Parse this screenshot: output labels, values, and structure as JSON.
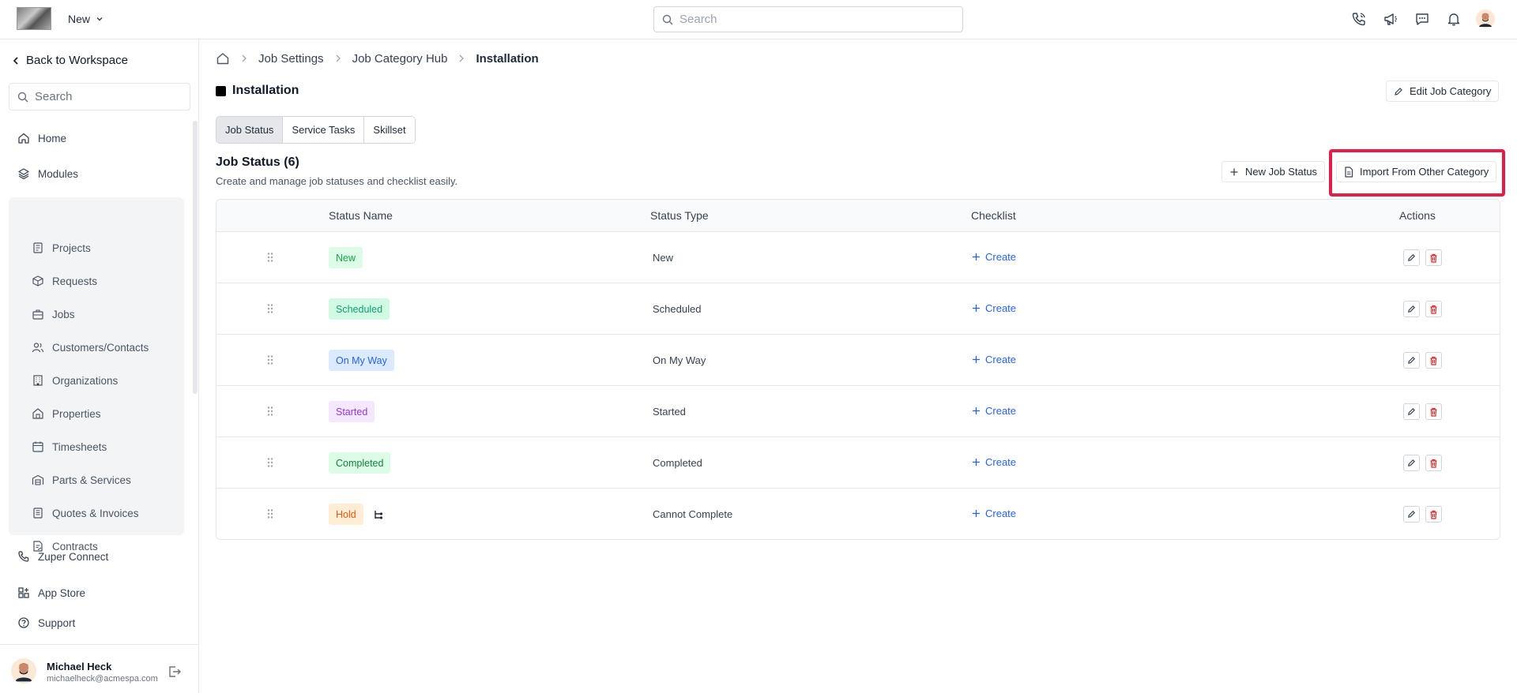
{
  "topbar": {
    "workspace": "New",
    "search_placeholder": "Search"
  },
  "sidebar": {
    "back": "Back to Workspace",
    "search_placeholder": "Search",
    "home": "Home",
    "modules": "Modules",
    "module_items": [
      {
        "label": "Projects",
        "icon": "projects-icon"
      },
      {
        "label": "Requests",
        "icon": "requests-icon"
      },
      {
        "label": "Jobs",
        "icon": "briefcase-icon"
      },
      {
        "label": "Customers/Contacts",
        "icon": "users-icon"
      },
      {
        "label": "Organizations",
        "icon": "building-icon"
      },
      {
        "label": "Properties",
        "icon": "property-icon"
      },
      {
        "label": "Timesheets",
        "icon": "calendar-icon"
      },
      {
        "label": "Parts & Services",
        "icon": "warehouse-icon"
      },
      {
        "label": "Quotes & Invoices",
        "icon": "invoice-icon"
      },
      {
        "label": "Contracts",
        "icon": "contract-icon"
      }
    ],
    "zuper_connect": "Zuper Connect",
    "app_store": "App Store",
    "support": "Support",
    "user": {
      "name": "Michael Heck",
      "email": "michaelheck@acmespa.com"
    }
  },
  "breadcrumb": [
    "Job Settings",
    "Job Category Hub",
    "Installation"
  ],
  "page": {
    "title": "Installation",
    "edit_button": "Edit Job Category",
    "tabs": [
      "Job Status",
      "Service Tasks",
      "Skillset"
    ],
    "active_tab": "Job Status",
    "section_title": "Job Status (6)",
    "section_desc": "Create and manage job statuses and checklist easily.",
    "new_button": "New Job Status",
    "import_button": "Import From Other Category"
  },
  "table": {
    "headers": [
      "Status Name",
      "Status Type",
      "Checklist",
      "Actions"
    ],
    "rows": [
      {
        "name": "New",
        "type": "New",
        "checklist": "Create",
        "bg": "#dcfce7",
        "fg": "#16a34a"
      },
      {
        "name": "Scheduled",
        "type": "Scheduled",
        "checklist": "Create",
        "bg": "#d1fae5",
        "fg": "#0f9f6e"
      },
      {
        "name": "On My Way",
        "type": "On My Way",
        "checklist": "Create",
        "bg": "#dbeafe",
        "fg": "#2563eb"
      },
      {
        "name": "Started",
        "type": "Started",
        "checklist": "Create",
        "bg": "#f3e8ff",
        "fg": "#9333ea"
      },
      {
        "name": "Completed",
        "type": "Completed",
        "checklist": "Create",
        "bg": "#dcfce7",
        "fg": "#15803d"
      },
      {
        "name": "Hold",
        "type": "Cannot Complete",
        "checklist": "Create",
        "bg": "#ffedd5",
        "fg": "#ea580c"
      }
    ]
  }
}
